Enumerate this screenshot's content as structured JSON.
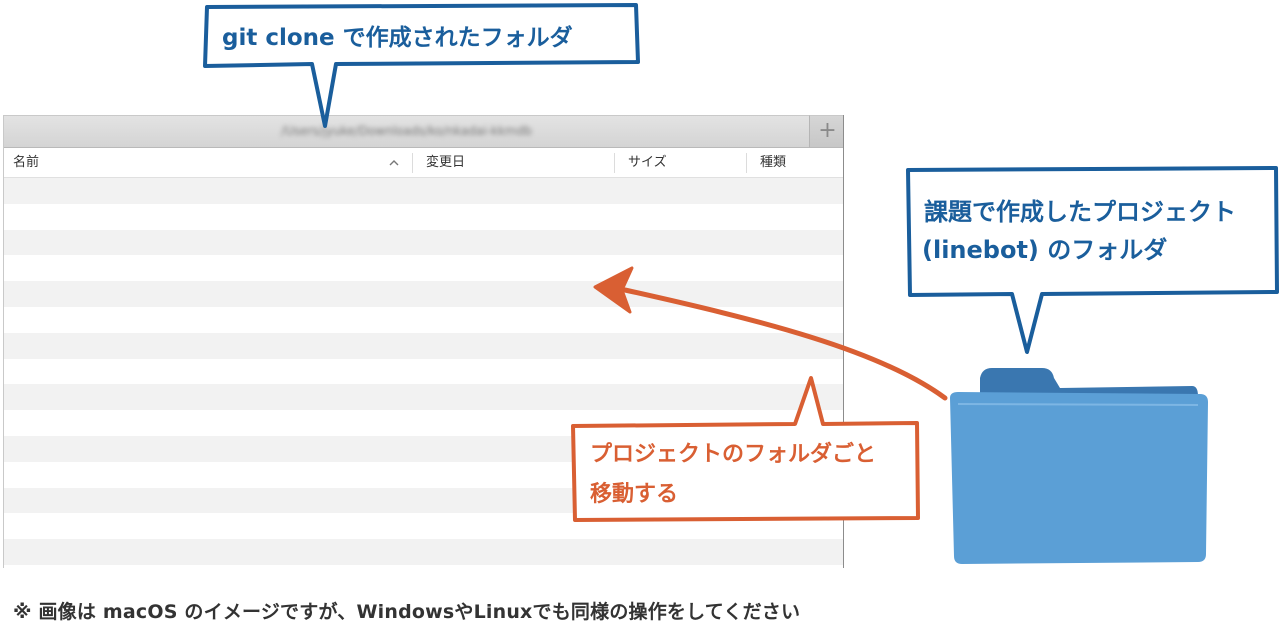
{
  "finder": {
    "path": "/Users/jyuke/Downloads/ko/nkadai-kkmdb",
    "add_tab_symbol": "+",
    "columns": [
      {
        "label": "名前"
      },
      {
        "label": "変更日"
      },
      {
        "label": "サイズ"
      },
      {
        "label": "種類"
      }
    ],
    "row_count": 15
  },
  "annotations": {
    "clone_folder": "git clone で作成されたフォルダ",
    "project_folder_line1": "課題で作成したプロジェクト",
    "project_folder_line2": "(linebot) のフォルダ",
    "move_line1": "プロジェクトのフォルダごと",
    "move_line2": "移動する"
  },
  "footnote": "※  画像は macOS のイメージですが、WindowsやLinuxでも同様の操作をしてください",
  "colors": {
    "annotation_blue": "#1a5e9c",
    "annotation_orange": "#d95f33",
    "folder_blue": "#5b9fd6",
    "folder_tab": "#3a77b0"
  },
  "icons": [
    "folder-icon",
    "add-tab-icon",
    "sort-ascending-icon",
    "arrow-icon"
  ]
}
